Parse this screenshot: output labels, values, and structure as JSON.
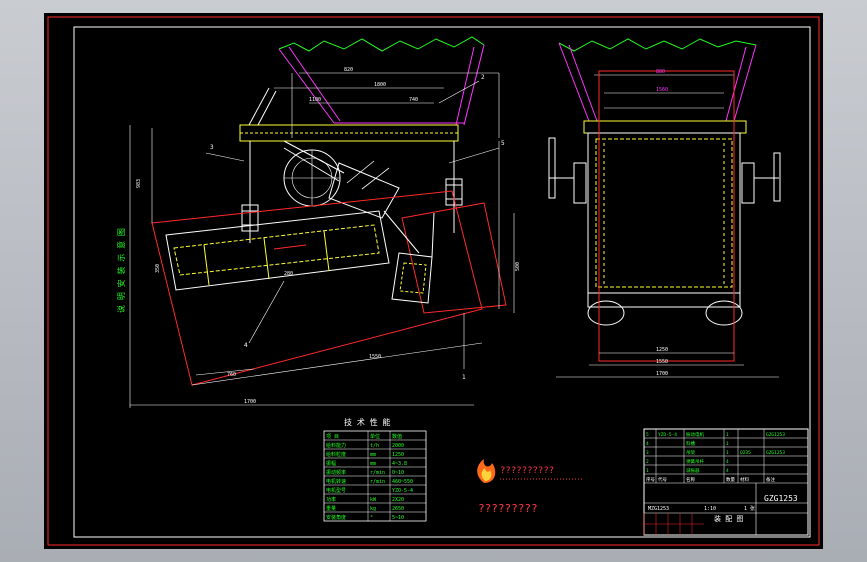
{
  "drawing": {
    "notes_title": "技 术 性 能",
    "side_text": "说 明 安 装 示 意 图",
    "logo_caption": "??????????",
    "logo_caption2": "?????????",
    "title_block": {
      "drawing_number": "GZG1253",
      "drawing_name": "装 配 图",
      "unit": "MZG1253",
      "scale": "1:10",
      "sheet": "1 张",
      "rows": [
        {
          "no": "5",
          "code": "YZO-5-4",
          "name": "振动电机",
          "qty": "1",
          "mat": "",
          "note": "GZG1253"
        },
        {
          "no": "4",
          "code": "",
          "name": "料槽",
          "qty": "1",
          "mat": "",
          "note": ""
        },
        {
          "no": "3",
          "code": "",
          "name": "吊架",
          "qty": "1",
          "mat": "Q235",
          "note": "GZG1253"
        },
        {
          "no": "2",
          "code": "",
          "name": "弹簧吊杆",
          "qty": "4",
          "mat": "",
          "note": ""
        },
        {
          "no": "1",
          "code": "",
          "name": "减振器",
          "qty": "4",
          "mat": "",
          "note": ""
        }
      ],
      "header": [
        "序号",
        "代号",
        "名称",
        "数量",
        "材料",
        "备注"
      ]
    },
    "spec_table": {
      "header": [
        "项 目",
        "单位",
        "数值"
      ],
      "rows": [
        [
          "给料能力",
          "t/h",
          "2000"
        ],
        [
          "给料粒度",
          "mm",
          "1250"
        ],
        [
          "振幅",
          "mm",
          "4~3.8"
        ],
        [
          "振动频率",
          "r/min",
          "0~10"
        ],
        [
          "电机转速",
          "r/min",
          "460~550"
        ],
        [
          "电机型号",
          "",
          "YZO-5-4"
        ],
        [
          "功率",
          "kW",
          "2X20"
        ],
        [
          "重量",
          "kg",
          "2650"
        ],
        [
          "安装角度",
          "°",
          "5~10"
        ]
      ]
    },
    "left_dims": [
      "1800",
      "820",
      "1100",
      "740",
      "983",
      "280",
      "1550",
      "350",
      "760",
      "1250",
      "1700",
      "300",
      "500"
    ],
    "right_dims": [
      "1250",
      "1550",
      "1700",
      "880",
      "1560"
    ],
    "callouts": [
      "1",
      "2",
      "3",
      "4",
      "5"
    ]
  }
}
